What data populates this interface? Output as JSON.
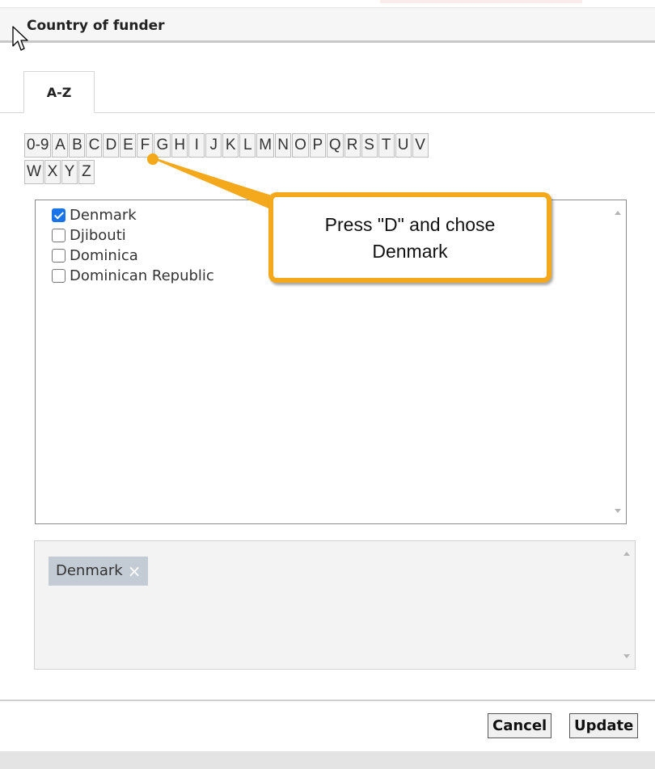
{
  "dialog": {
    "title": "Country of funder"
  },
  "tabs": [
    {
      "label": "A-Z"
    }
  ],
  "letters": [
    "0-9",
    "A",
    "B",
    "C",
    "D",
    "E",
    "F",
    "G",
    "H",
    "I",
    "J",
    "K",
    "L",
    "M",
    "N",
    "O",
    "P",
    "Q",
    "R",
    "S",
    "T",
    "U",
    "V",
    "W",
    "X",
    "Y",
    "Z"
  ],
  "countries": [
    {
      "label": "Denmark",
      "checked": true
    },
    {
      "label": "Djibouti",
      "checked": false
    },
    {
      "label": "Dominica",
      "checked": false
    },
    {
      "label": "Dominican Republic",
      "checked": false
    }
  ],
  "selected": [
    {
      "label": "Denmark",
      "remove": "×"
    }
  ],
  "buttons": {
    "cancel": "Cancel",
    "update": "Update"
  },
  "annotation": {
    "line1": "Press \"D\" and chose",
    "line2": "Denmark"
  },
  "colors": {
    "callout": "#f4a81c",
    "chip": "#c3ccd4",
    "checkbox": "#1a73e8"
  },
  "icons": {
    "cursor": "mouse-pointer-icon",
    "chip_remove": "close-icon"
  }
}
